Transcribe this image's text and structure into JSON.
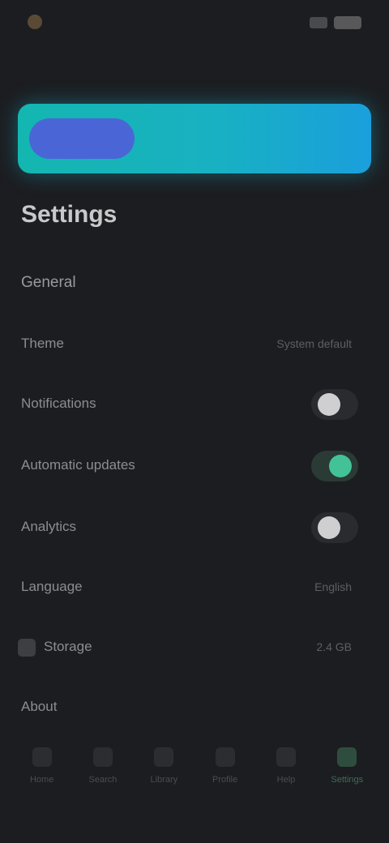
{
  "status_bar": {
    "time": "",
    "icons": [
      "app-icon",
      "signal-icon",
      "battery-icon"
    ]
  },
  "banner": {
    "pill_label": "",
    "text": "",
    "colors": {
      "start": "#14b6b0",
      "end": "#1a9fdc",
      "pill": "#4a66d6"
    }
  },
  "page": {
    "title": "Settings"
  },
  "section": {
    "title": "General"
  },
  "rows": [
    {
      "label": "Theme",
      "value": "System default"
    },
    {
      "label": "Notifications",
      "toggle": "off"
    },
    {
      "label": "Automatic updates",
      "toggle": "on"
    },
    {
      "label": "Analytics",
      "toggle": "off"
    },
    {
      "label": "Language",
      "value": "English"
    },
    {
      "label": "Storage",
      "value": "2.4 GB"
    },
    {
      "label": "About"
    }
  ],
  "nav": {
    "items": [
      {
        "label": "Home",
        "icon": "home-icon"
      },
      {
        "label": "Search",
        "icon": "search-icon"
      },
      {
        "label": "Library",
        "icon": "library-icon"
      },
      {
        "label": "Profile",
        "icon": "profile-icon"
      },
      {
        "label": "Help",
        "icon": "help-icon"
      },
      {
        "label": "Settings",
        "icon": "gear-icon",
        "active": true
      }
    ]
  },
  "colors": {
    "background": "#1c1d20",
    "accent": "#43c298"
  }
}
